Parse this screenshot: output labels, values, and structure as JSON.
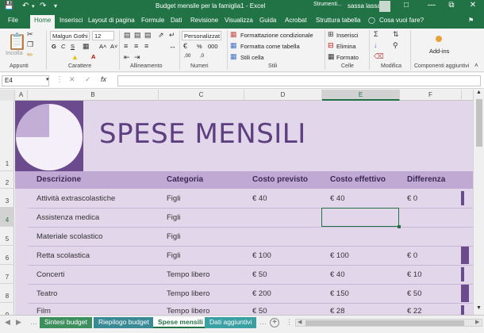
{
  "titlebar": {
    "title": "Budget mensile per la famiglia1  -  Excel",
    "context": "Strumenti...",
    "user": "sassa lassa",
    "bg": "#217346"
  },
  "tabs": [
    "File",
    "Home",
    "Inserisci",
    "Layout di pagina",
    "Formule",
    "Dati",
    "Revisione",
    "Visualizza",
    "Guida",
    "Acrobat",
    "Struttura tabella"
  ],
  "tell_me": "Cosa vuoi fare?",
  "ribbon": {
    "paste": "Incolla",
    "font_name": "Malgun Gothi",
    "font_size": "12",
    "number_format": "Personalizzat",
    "cond_format": "Formattazione condizionale",
    "format_table": "Formatta come tabella",
    "cell_styles": "Stili cella",
    "insert": "Inserisci",
    "delete": "Elimina",
    "format": "Formato",
    "addins": "Add-ins",
    "groups": [
      "Appunti",
      "Carattere",
      "Allineamento",
      "Numeri",
      "Stili",
      "Celle",
      "Modifica",
      "Componenti aggiuntivi"
    ]
  },
  "formula_bar": {
    "name_box": "E4",
    "formula": ""
  },
  "columns": [
    "A",
    "B",
    "C",
    "D",
    "E",
    "F"
  ],
  "rows": [
    "1",
    "2",
    "3",
    "4",
    "5",
    "6",
    "7",
    "8",
    "9"
  ],
  "sheet": {
    "title": "SPESE MENSILI",
    "headers": [
      "Descrizione",
      "Categoria",
      "Costo previsto",
      "Costo effettivo",
      "Differenza"
    ],
    "data": [
      [
        "Attività extrascolastiche",
        "Figli",
        "€ 40",
        "€ 40",
        "€ 0"
      ],
      [
        "Assistenza medica",
        "Figli",
        "",
        "",
        ""
      ],
      [
        "Materiale scolastico",
        "Figli",
        "",
        "",
        ""
      ],
      [
        "Retta scolastica",
        "Figli",
        "€ 100",
        "€ 100",
        "€ 0"
      ],
      [
        "Concerti",
        "Tempo libero",
        "€ 50",
        "€ 40",
        "€ 10"
      ],
      [
        "Teatro",
        "Tempo libero",
        "€ 200",
        "€ 150",
        "€ 50"
      ],
      [
        "Film",
        "Tempo libero",
        "€ 50",
        "€ 28",
        "€ 22"
      ]
    ],
    "colors": {
      "banner": "#6b4b8e",
      "bg": "#e2d6ea",
      "header": "#c0a9d3",
      "pie_light": "#c3aed5",
      "pie_white": "#f4eff8"
    }
  },
  "sheet_tabs": [
    {
      "label": "Sintesi budget",
      "color": "#3e8f5e"
    },
    {
      "label": "Riepilogo budget",
      "color": "#3a8a96"
    },
    {
      "label": "Spese mensili",
      "color": "#ffffff"
    },
    {
      "label": "Dati aggiuntivi",
      "color": "#3aa0a4"
    }
  ]
}
